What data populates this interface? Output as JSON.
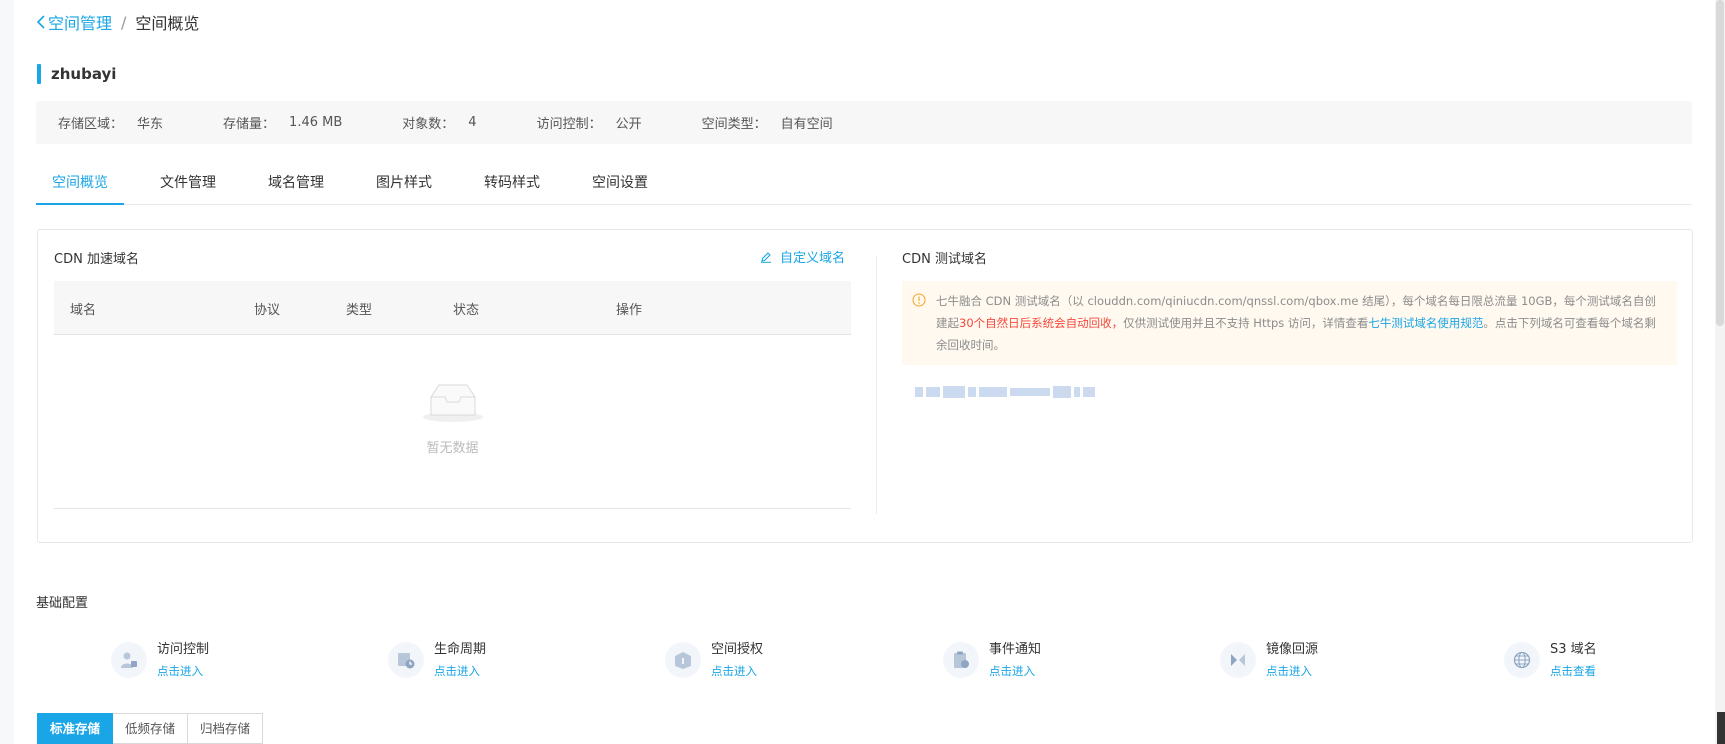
{
  "breadcrumb": {
    "back_label": "空间管理",
    "separator": "/",
    "current": "空间概览"
  },
  "bucket": {
    "name": "zhubayi"
  },
  "info": [
    {
      "label": "存储区域：",
      "value": "华东"
    },
    {
      "label": "存储量：",
      "value": "1.46 MB"
    },
    {
      "label": "对象数：",
      "value": "4"
    },
    {
      "label": "访问控制：",
      "value": "公开"
    },
    {
      "label": "空间类型：",
      "value": "自有空间"
    }
  ],
  "tabs": [
    {
      "label": "空间概览",
      "active": true
    },
    {
      "label": "文件管理"
    },
    {
      "label": "域名管理"
    },
    {
      "label": "图片样式"
    },
    {
      "label": "转码样式"
    },
    {
      "label": "空间设置"
    }
  ],
  "cdn": {
    "title": "CDN 加速域名",
    "custom_domain_label": "自定义域名",
    "columns": [
      "域名",
      "协议",
      "类型",
      "状态",
      "操作"
    ],
    "empty_text": "暂无数据"
  },
  "test_domain": {
    "title": "CDN 测试域名",
    "notice_part1": "七牛融合 CDN 测试域名（以 clouddn.com/qiniucdn.com/qnssl.com/qbox.me 结尾），每个域名每日限总流量 10GB，每个测试域名自创建起",
    "notice_highlight": "30个自然日后系统会自动回收，",
    "notice_part2": "仅供测试使用并且不支持 Https 访问，详情查看",
    "notice_link": "七牛测试域名使用规范",
    "notice_part3": "。点击下列域名可查看每个域名剩余回收时间。"
  },
  "basic_config": {
    "title": "基础配置",
    "items": [
      {
        "name": "访问控制",
        "link": "点击进入",
        "icon": "access-control-icon"
      },
      {
        "name": "生命周期",
        "link": "点击进入",
        "icon": "lifecycle-icon"
      },
      {
        "name": "空间授权",
        "link": "点击进入",
        "icon": "space-authorization-icon"
      },
      {
        "name": "事件通知",
        "link": "点击进入",
        "icon": "event-notification-icon"
      },
      {
        "name": "镜像回源",
        "link": "点击进入",
        "icon": "mirror-source-icon"
      },
      {
        "name": "S3 域名",
        "link": "点击查看",
        "icon": "globe-icon"
      }
    ]
  },
  "storage_tabs": [
    {
      "label": "标准存储",
      "active": true
    },
    {
      "label": "低频存储"
    },
    {
      "label": "归档存储"
    }
  ],
  "colors": {
    "accent": "#1aa5e6",
    "warning_bg": "#fff9f0",
    "highlight_red": "#f5483b"
  }
}
